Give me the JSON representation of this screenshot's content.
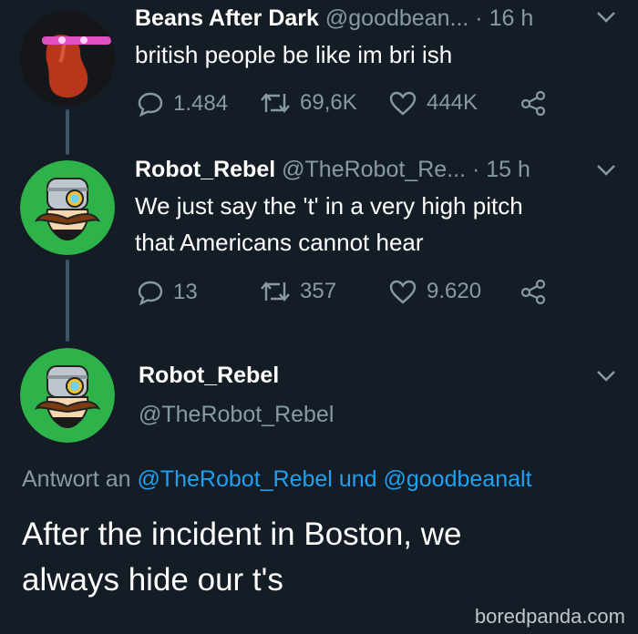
{
  "tweet1": {
    "name": "Beans After Dark",
    "handle": "@goodbean...",
    "time": "· 16 h",
    "text": "british people be like im bri ish",
    "replies": "1.484",
    "retweets": "69,6K",
    "likes": "444K"
  },
  "tweet2": {
    "name": "Robot_Rebel",
    "handle": "@TheRobot_Re...",
    "time": "· 15 h",
    "text_line1": "We just say the 't' in a very high pitch",
    "text_line2": "that Americans cannot hear",
    "replies": "13",
    "retweets": "357",
    "likes": "9.620"
  },
  "tweet3": {
    "name": "Robot_Rebel",
    "handle": "@TheRobot_Rebel",
    "reply_prefix": "Antwort an",
    "reply_mention1": "@TheRobot_Rebel",
    "reply_conj": "und",
    "reply_mention2": "@goodbeanalt",
    "text_line1": "After the incident in Boston, we",
    "text_line2": "always hide our t's"
  },
  "watermark": "boredpanda.com",
  "colors": {
    "background": "#141d26",
    "secondary_text": "#8899a6",
    "link": "#1da1f2",
    "avatar_green": "#2db34a"
  }
}
